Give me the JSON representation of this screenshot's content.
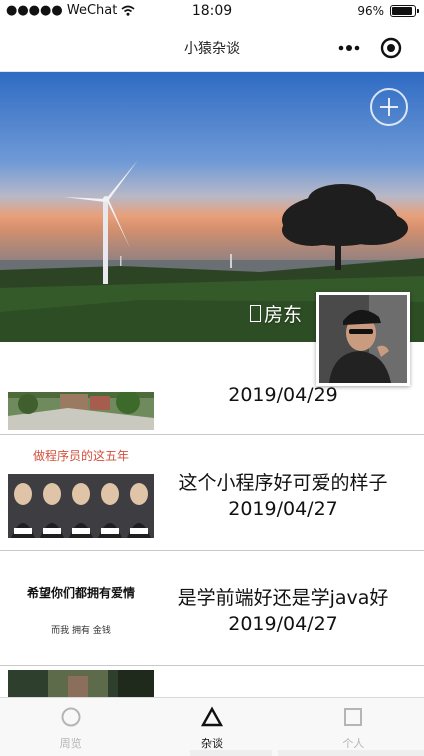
{
  "status_bar": {
    "carrier": "●●●●● WeChat",
    "time": "18:09",
    "battery_percent": "96%",
    "battery_level": 0.96
  },
  "nav": {
    "title": "小猿杂谈"
  },
  "profile": {
    "name": "房东"
  },
  "posts": [
    {
      "title": "",
      "date": "2019/04/29"
    },
    {
      "title": "这个小程序好可爱的样子",
      "date": "2019/04/27",
      "thumb_caption": "做程序员的这五年"
    },
    {
      "title": "是学前端好还是学java好",
      "date": "2019/04/27",
      "thumb_line1": "希望你们都拥有爱情",
      "thumb_line2": "而我 拥有 金钱"
    }
  ],
  "tabs": [
    {
      "label": "周览",
      "icon": "circle-icon",
      "active": false
    },
    {
      "label": "杂谈",
      "icon": "triangle-icon",
      "active": true
    },
    {
      "label": "个人",
      "icon": "square-icon",
      "active": false
    }
  ],
  "colors": {
    "tab_active": "#111111",
    "tab_inactive": "#b5b5b5",
    "divider": "#c8c8c8"
  }
}
